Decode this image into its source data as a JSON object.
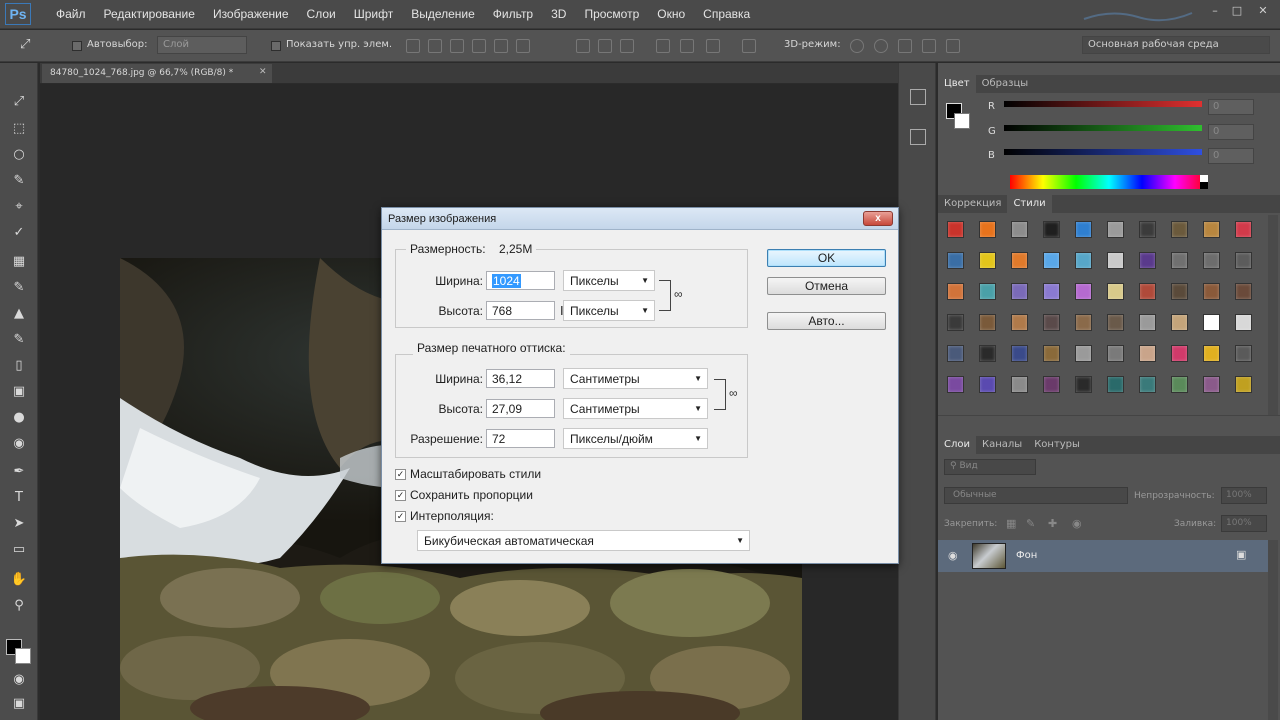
{
  "app": {
    "logo": "Ps"
  },
  "menu": [
    "Файл",
    "Редактирование",
    "Изображение",
    "Слои",
    "Шрифт",
    "Выделение",
    "Фильтр",
    "3D",
    "Просмотр",
    "Окно",
    "Справка"
  ],
  "options": {
    "autoselect_label": "Автовыбор:",
    "autoselect_value": "Слой",
    "show_controls_label": "Показать упр. элем.",
    "mode_3d_label": "3D-режим:",
    "workspace": "Основная рабочая среда"
  },
  "document_tab": "84780_1024_768.jpg @ 66,7% (RGB/8) *",
  "color_panel": {
    "tabs": [
      "Цвет",
      "Образцы"
    ],
    "channels": [
      {
        "label": "R",
        "value": "0",
        "color": "#e03030"
      },
      {
        "label": "G",
        "value": "0",
        "color": "#2fbf2f"
      },
      {
        "label": "B",
        "value": "0",
        "color": "#2f4fe0"
      }
    ]
  },
  "styles_panel": {
    "tabs": [
      "Коррекция",
      "Стили"
    ]
  },
  "layers_panel": {
    "tabs": [
      "Слои",
      "Каналы",
      "Контуры"
    ],
    "filter_kind": "Вид",
    "blend_mode": "Обычные",
    "opacity_label": "Непрозрачность:",
    "opacity_value": "100%",
    "lock_label": "Закрепить:",
    "fill_label": "Заливка:",
    "fill_value": "100%",
    "layer_name": "Фон"
  },
  "dialog": {
    "title": "Размер изображения",
    "close": "x",
    "pixel_dims_label": "Размерность:",
    "pixel_dims_value": "2,25M",
    "width_label": "Ширина:",
    "width_value": "1024",
    "width_unit": "Пикселы",
    "height_label": "Высота:",
    "height_value": "768",
    "height_unit": "Пикселы",
    "print_size_label": "Размер печатного оттиска:",
    "print_width_label": "Ширина:",
    "print_width_value": "36,12",
    "print_width_unit": "Сантиметры",
    "print_height_label": "Высота:",
    "print_height_value": "27,09",
    "print_height_unit": "Сантиметры",
    "resolution_label": "Разрешение:",
    "resolution_value": "72",
    "resolution_unit": "Пикселы/дюйм",
    "scale_styles": "Масштабировать стили",
    "constrain": "Сохранить пропорции",
    "resample": "Интерполяция:",
    "resample_method": "Бикубическая автоматическая",
    "ok": "OK",
    "cancel": "Отмена",
    "auto": "Авто..."
  }
}
